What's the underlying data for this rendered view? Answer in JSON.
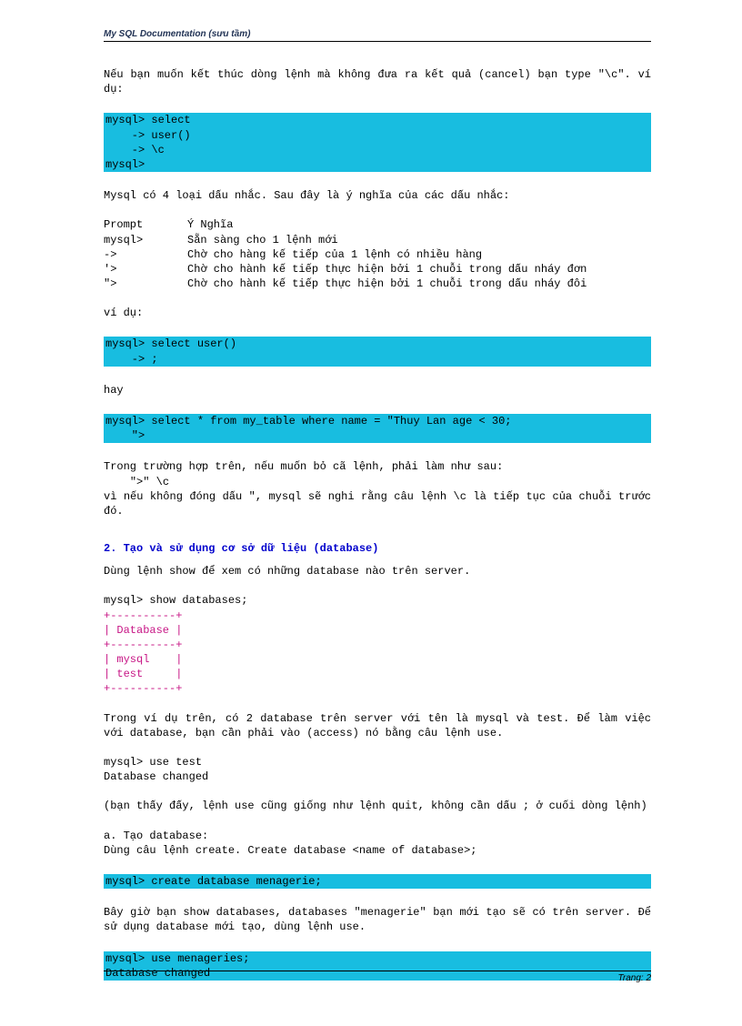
{
  "header": "My SQL Documentation (sưu tầm)",
  "para1": "Nếu bạn muốn kết thúc dòng lệnh mà không đưa ra kết quả (cancel) bạn type \"\\c\". ví dụ:",
  "code1": "mysql> select\n    -> user()\n    -> \\c\nmysql>",
  "para2": "Mysql có 4 loại dấu nhắc. Sau đây là ý nghĩa của các dấu nhắc:",
  "table": {
    "rows": [
      {
        "c1": "Prompt",
        "c2": "Ý Nghĩa"
      },
      {
        "c1": "mysql>",
        "c2": "Sẵn sàng cho 1 lệnh mới"
      },
      {
        "c1": "->",
        "c2": "Chờ cho hàng kế tiếp của 1 lệnh có nhiều hàng"
      },
      {
        "c1": "'>",
        "c2": "Chờ cho hành kế tiếp thực hiện bởi 1 chuỗi trong dấu nháy đơn"
      },
      {
        "c1": "\">",
        "c2": "Chờ cho hành kế tiếp thực hiện bởi 1 chuỗi trong dấu nháy đôi"
      }
    ]
  },
  "para3": "ví dụ:",
  "code2": "mysql> select user()\n    -> ;",
  "para4": "hay",
  "code3": "mysql> select * from my_table where name = \"Thuy Lan age < 30;\n    \">",
  "para5a": "Trong trường hợp trên, nếu muốn bỏ cã lệnh, phải làm như sau:",
  "para5b": "    \">\" \\c",
  "para5c": "vì nếu không đóng dấu \", mysql sẽ nghi rằng câu lệnh \\c là tiếp tục của chuỗi trước đó.",
  "heading2": "2. Tạo và sử dụng cơ sở dữ liệu (database)",
  "para6": "Dùng lệnh show để xem có những database nào trên server.",
  "para7": "mysql> show databases;",
  "db_output": "+----------+\n| Database |\n+----------+\n| mysql    |\n| test     |\n+----------+",
  "para8": "Trong ví dụ trên, có 2 database trên server với tên là mysql và test. Để làm việc với database, bạn cần phải vào (access) nó bằng câu lệnh use.",
  "para9": "mysql> use test\nDatabase changed",
  "para10": "(bạn thấy đấy, lệnh use cũng giống như lệnh quit, không cần dấu ; ở cuối dòng lệnh)",
  "para11": "a. Tạo database:\nDùng câu lệnh create. Create database <name of database>;",
  "code4": "mysql> create database menagerie;",
  "para12": "Bây giờ bạn show databases, databases \"menagerie\" bạn mới tạo sẽ có trên server. Để sử dụng database mới tạo, dùng lệnh use.",
  "code5": "mysql> use menageries;\nDatabase changed",
  "footer": "Trang: 2"
}
